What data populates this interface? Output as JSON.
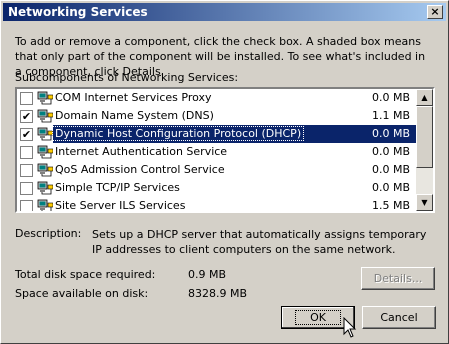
{
  "window": {
    "title": "Networking Services",
    "close": "×"
  },
  "intro_text": "To add or remove a component, click the check box. A shaded box means that only part of the component will be installed. To see what's included in a component, click Details.",
  "list_label": "Subcomponents of Networking Services:",
  "components": [
    {
      "name": "COM Internet Services Proxy",
      "size": "0.0 MB",
      "checked": false,
      "mark": ""
    },
    {
      "name": "Domain Name System (DNS)",
      "size": "1.1 MB",
      "checked": true,
      "mark": "✔"
    },
    {
      "name": "Dynamic Host Configuration Protocol (DHCP)",
      "size": "0.0 MB",
      "checked": true,
      "mark": "✔",
      "selected": true
    },
    {
      "name": "Internet Authentication Service",
      "size": "0.0 MB",
      "checked": false,
      "mark": ""
    },
    {
      "name": "QoS Admission Control Service",
      "size": "0.0 MB",
      "checked": false,
      "mark": ""
    },
    {
      "name": "Simple TCP/IP Services",
      "size": "0.0 MB",
      "checked": false,
      "mark": ""
    },
    {
      "name": "Site Server ILS Services",
      "size": "1.5 MB",
      "checked": false,
      "mark": ""
    }
  ],
  "scroll": {
    "up": "▲",
    "down": "▼"
  },
  "description": {
    "label": "Description:",
    "text": "Sets up a DHCP server that automatically assigns temporary IP addresses to client computers on the same network."
  },
  "disk": {
    "required_label": "Total disk space required:",
    "required_value": "0.9 MB",
    "available_label": "Space available on disk:",
    "available_value": "8328.9 MB"
  },
  "buttons": {
    "details": "Details...",
    "ok": "OK",
    "cancel": "Cancel"
  },
  "colors": {
    "title_bar": "#0a246a",
    "selection": "#0a246a",
    "face": "#d4d0c8"
  }
}
